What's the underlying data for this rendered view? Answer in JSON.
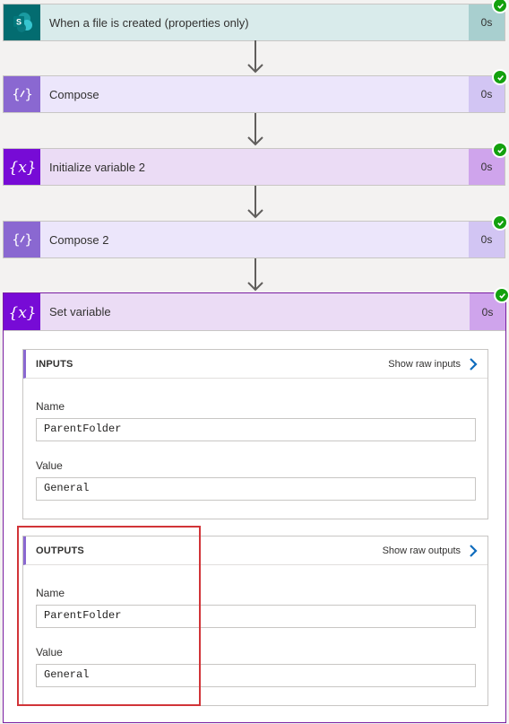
{
  "colors": {
    "sharepoint_icon_bg": "#036c70",
    "trigger_bg": "#d9ebeb",
    "trigger_dur_bg": "#a8cfcf",
    "compose_icon_bg": "#8a68d1",
    "compose_bg": "#ece6fb",
    "compose_dur_bg": "#d2c5f3",
    "variable_icon_bg": "#770bd6",
    "variable_bg": "#ebdcf5",
    "variable_dur_bg": "#cfa4ec",
    "success": "#13a10e",
    "highlight_border": "#d13438"
  },
  "steps": [
    {
      "title": "When a file is created (properties only)",
      "duration": "0s",
      "icon": "sharepoint-icon"
    },
    {
      "title": "Compose",
      "duration": "0s",
      "icon": "compose-icon"
    },
    {
      "title": "Initialize variable 2",
      "duration": "0s",
      "icon": "variable-icon"
    },
    {
      "title": "Compose 2",
      "duration": "0s",
      "icon": "compose-icon"
    },
    {
      "title": "Set variable",
      "duration": "0s",
      "icon": "variable-icon"
    }
  ],
  "inputs": {
    "header": "INPUTS",
    "raw_link": "Show raw inputs",
    "name_label": "Name",
    "name_value": "ParentFolder",
    "value_label": "Value",
    "value_value": "General"
  },
  "outputs": {
    "header": "OUTPUTS",
    "raw_link": "Show raw outputs",
    "name_label": "Name",
    "name_value": "ParentFolder",
    "value_label": "Value",
    "value_value": "General"
  }
}
